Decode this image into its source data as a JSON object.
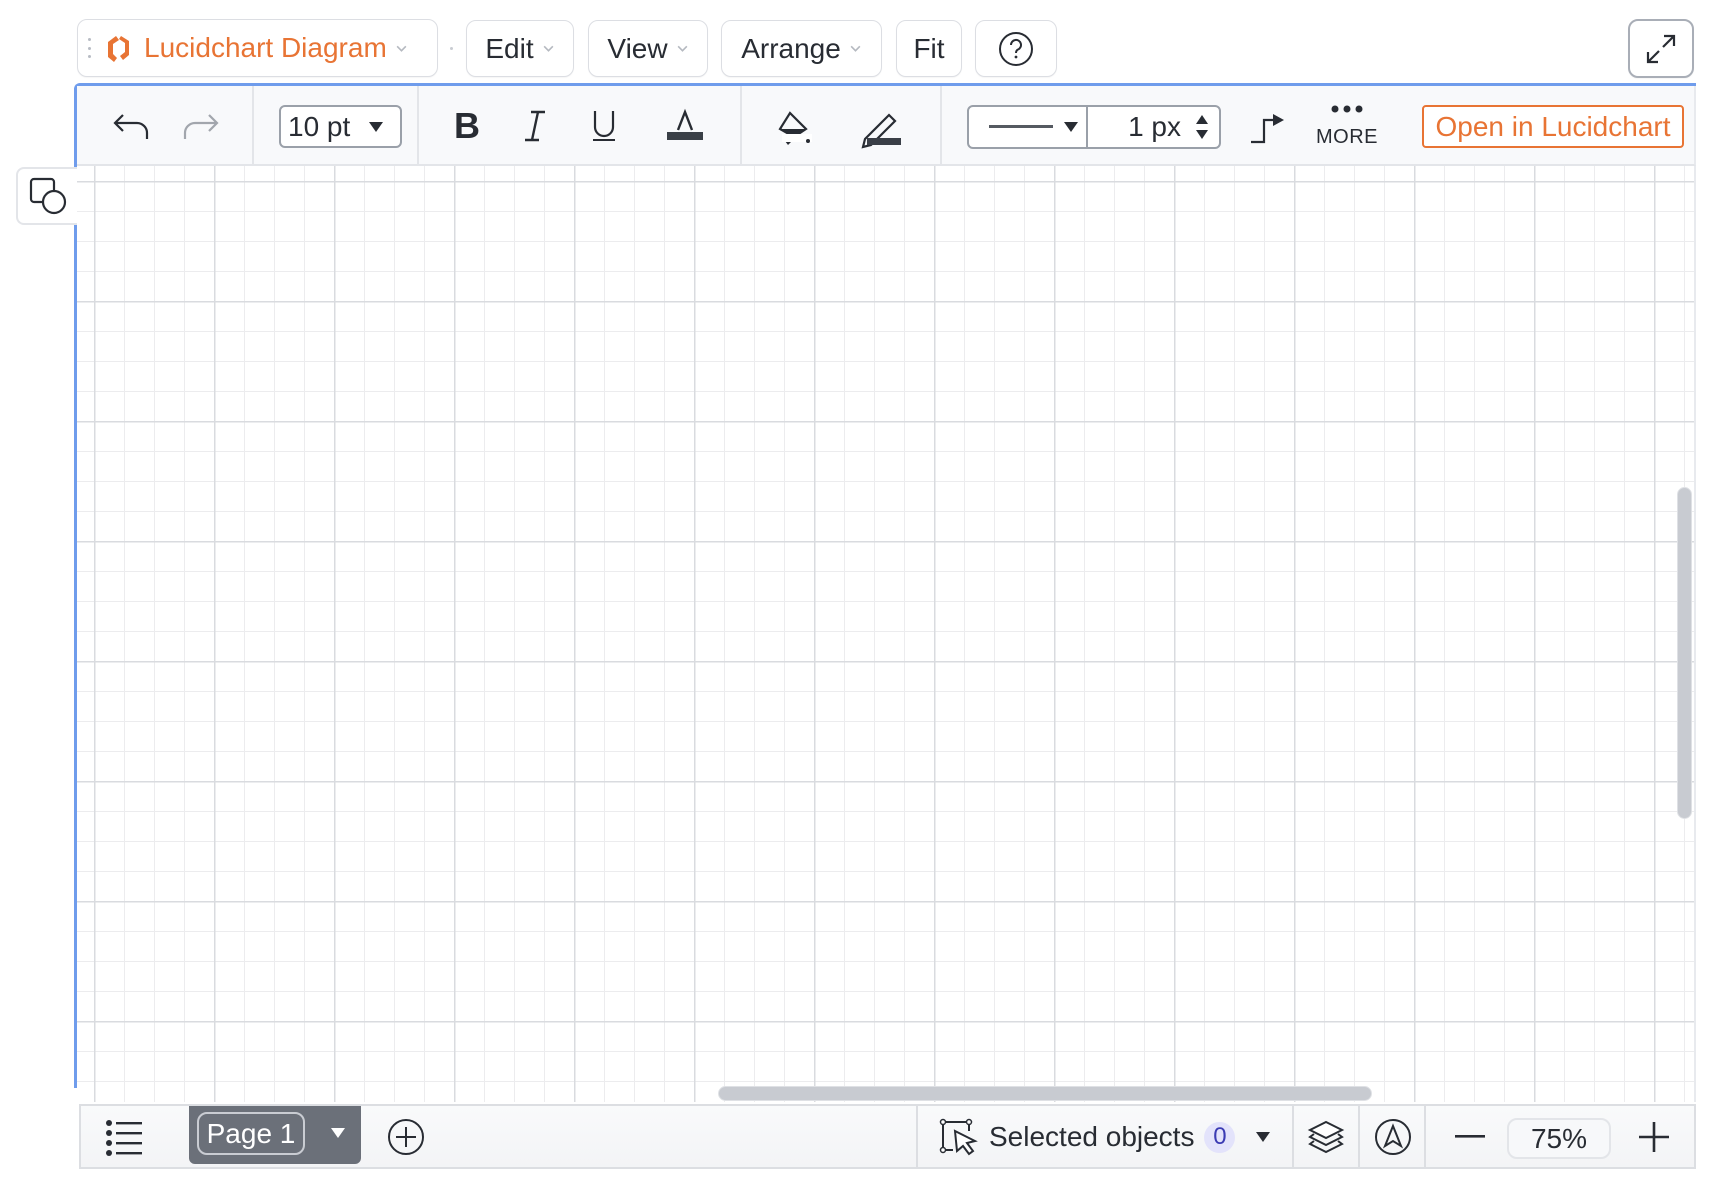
{
  "topbar": {
    "title": "Lucidchart Diagram",
    "menus": [
      {
        "label": "Edit"
      },
      {
        "label": "View"
      },
      {
        "label": "Arrange"
      }
    ],
    "fit_label": "Fit",
    "help_icon": "question-circle-icon",
    "expand_icon": "expand-arrows-icon"
  },
  "toolbar": {
    "undo_icon": "undo-icon",
    "redo_icon": "redo-icon",
    "font_size": "10 pt",
    "bold_label": "B",
    "italic_label": "I",
    "underline_label": "U",
    "text_color_icon": "text-color-icon",
    "fill_color_icon": "fill-bucket-icon",
    "line_color_icon": "pencil-line-color-icon",
    "line_style_icon": "line-style-solid-icon",
    "line_width": "1 px",
    "connector_icon": "elbow-connector-icon",
    "more_label": "MORE",
    "open_button_label": "Open in Lucidchart"
  },
  "sidebar": {
    "shapes_icon": "shapes-icon"
  },
  "bottombar": {
    "page_list_icon": "list-icon",
    "page_tab_label": "Page 1",
    "add_page_icon": "add-circle-icon",
    "selected_objects_label": "Selected objects",
    "selected_objects_count": "0",
    "layers_icon": "layers-icon",
    "navigation_icon": "navigation-icon",
    "zoom_out_icon": "minus-icon",
    "zoom_level": "75%",
    "zoom_in_icon": "plus-icon"
  },
  "colors": {
    "brand_orange": "#e87434",
    "frame_blue": "#6f9cec",
    "badge_bg": "#e3e3fb",
    "badge_text": "#3b3bb3"
  }
}
